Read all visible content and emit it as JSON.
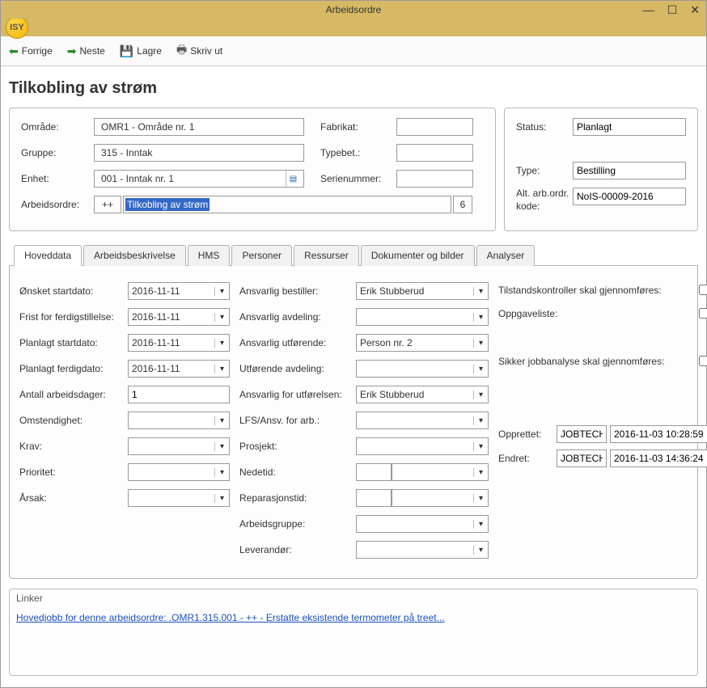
{
  "window": {
    "title": "Arbeidsordre",
    "controls": {
      "min": "—",
      "max": "☐",
      "close": "✕"
    },
    "logo_text": "ISY"
  },
  "toolbar": {
    "back": "Forrige",
    "next": "Neste",
    "save": "Lagre",
    "print": "Skriv ut"
  },
  "page_title": "Tilkobling av strøm",
  "header_left": {
    "omrade_label": "Område:",
    "omrade_value": "OMR1 - Område nr. 1",
    "gruppe_label": "Gruppe:",
    "gruppe_value": "315 - Inntak",
    "enhet_label": "Enhet:",
    "enhet_value": "001 - Inntak nr. 1",
    "arbeidsordre_label": "Arbeidsordre:",
    "wo_plus": "++",
    "wo_title": "Tilkobling av strøm",
    "wo_num": "6",
    "fabrikat_label": "Fabrikat:",
    "fabrikat_value": "",
    "typebet_label": "Typebet.:",
    "typebet_value": "",
    "serienummer_label": "Serienummer:",
    "serienummer_value": ""
  },
  "header_right": {
    "status_label": "Status:",
    "status_value": "Planlagt",
    "type_label": "Type:",
    "type_value": "Bestilling",
    "altkode_label": "Alt. arb.ordr. kode:",
    "altkode_value": "NoIS-00009-2016"
  },
  "tabs": {
    "t0": "Hoveddata",
    "t1": "Arbeidsbeskrivelse",
    "t2": "HMS",
    "t3": "Personer",
    "t4": "Ressurser",
    "t5": "Dokumenter og bilder",
    "t6": "Analyser"
  },
  "details": {
    "col_a": {
      "onsket_start_l": "Ønsket startdato:",
      "onsket_start_v": "2016-11-11",
      "frist_l": "Frist for ferdigstillelse:",
      "frist_v": "2016-11-11",
      "planlagt_start_l": "Planlagt startdato:",
      "planlagt_start_v": "2016-11-11",
      "planlagt_ferdig_l": "Planlagt ferdigdato:",
      "planlagt_ferdig_v": "2016-11-11",
      "antall_l": "Antall arbeidsdager:",
      "antall_v": "1",
      "omst_l": "Omstendighet:",
      "omst_v": "",
      "krav_l": "Krav:",
      "krav_v": "",
      "prio_l": "Prioritet:",
      "prio_v": "",
      "arsak_l": "Årsak:",
      "arsak_v": ""
    },
    "col_b": {
      "ansv_best_l": "Ansvarlig bestiller:",
      "ansv_best_v": "Erik Stubberud",
      "ansv_avd_l": "Ansvarlig avdeling:",
      "ansv_avd_v": "",
      "ansv_utf_l": "Ansvarlig utførende:",
      "ansv_utf_v": "Person nr. 2",
      "utf_avd_l": "Utførende avdeling:",
      "utf_avd_v": "",
      "ansv_for_utf_l": "Ansvarlig for utførelsen:",
      "ansv_for_utf_v": "Erik Stubberud",
      "lfs_l": "LFS/Ansv. for arb.:",
      "lfs_v": "",
      "prosjekt_l": "Prosjekt:",
      "prosjekt_v": "",
      "nedetid_l": "Nedetid:",
      "nedetid_num": "",
      "nedetid_unit": "",
      "rep_l": "Reparasjonstid:",
      "rep_num": "",
      "rep_unit": "",
      "arbgr_l": "Arbeidsgruppe:",
      "arbgr_v": "",
      "lev_l": "Leverandør:",
      "lev_v": ""
    },
    "col_c": {
      "tilstand_l": "Tilstandskontroller skal gjennomføres:",
      "oppgave_l": "Oppgaveliste:",
      "sikker_l": "Sikker jobbanalyse skal gjennomføres:",
      "opprettet_l": "Opprettet:",
      "opprettet_user": "JOBTECH",
      "opprettet_time": "2016-11-03 10:28:59",
      "endret_l": "Endret:",
      "endret_user": "JOBTECH",
      "endret_time": "2016-11-03 14:36:24"
    }
  },
  "linker": {
    "title": "Linker",
    "link_text": "Hovedjobb for denne arbeidsordre: .OMR1.315.001 - ++ - Erstatte eksistende termometer på treet..."
  }
}
